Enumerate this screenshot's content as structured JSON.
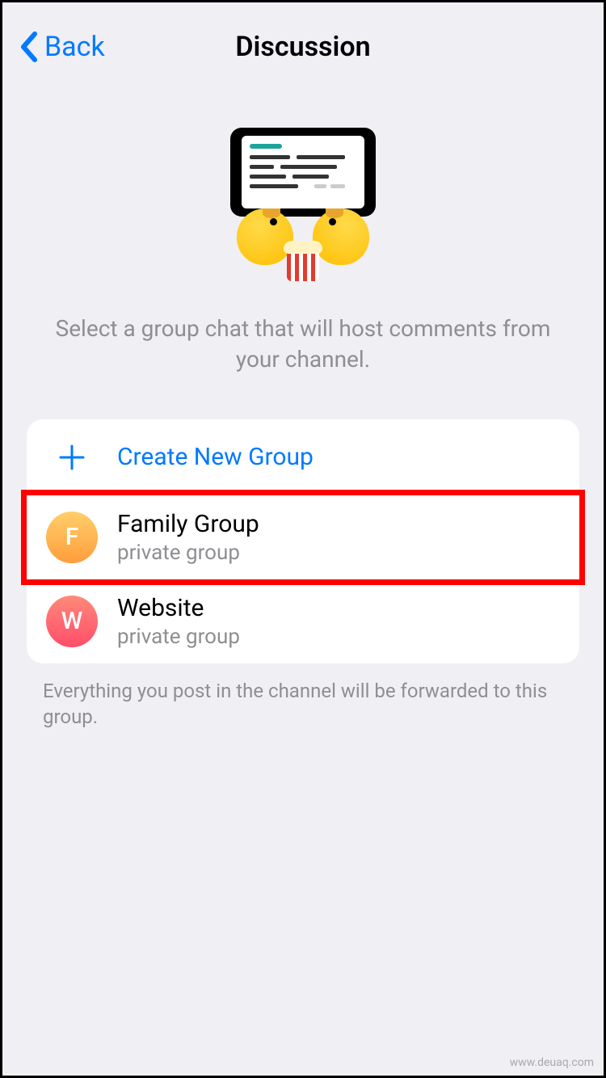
{
  "header": {
    "back_label": "Back",
    "title": "Discussion"
  },
  "description": "Select a group chat that will host comments from your channel.",
  "list": {
    "create": {
      "label": "Create New Group"
    },
    "items": [
      {
        "avatar_letter": "F",
        "title": "Family Group",
        "subtitle": "private group",
        "highlighted": true
      },
      {
        "avatar_letter": "W",
        "title": "Website",
        "subtitle": "private group",
        "highlighted": false
      }
    ]
  },
  "footer_note": "Everything you post in the channel will be forwarded to this group.",
  "watermark": "www.deuaq.com"
}
